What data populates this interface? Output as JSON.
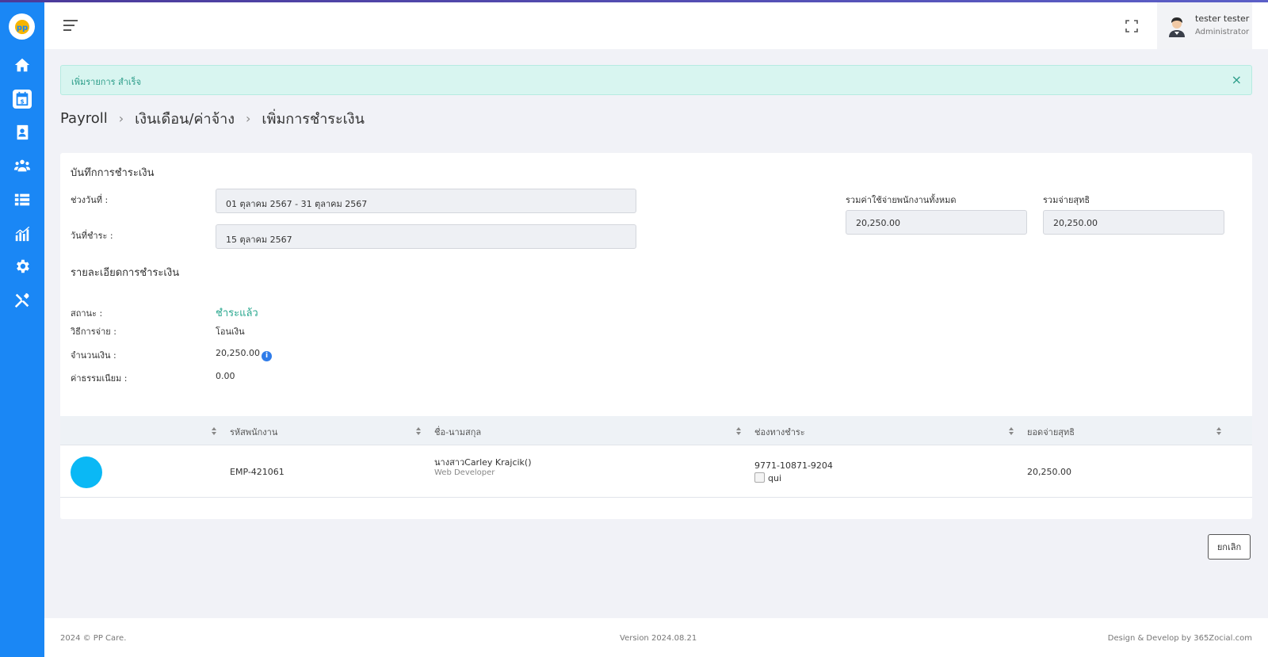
{
  "header": {
    "user_name": "tester tester",
    "user_role": "Administrator"
  },
  "sidebar": {
    "items": [
      {
        "icon": "home-icon"
      },
      {
        "icon": "payroll-calendar-icon",
        "active": true
      },
      {
        "icon": "contact-book-icon"
      },
      {
        "icon": "team-icon"
      },
      {
        "icon": "list-icon"
      },
      {
        "icon": "chart-icon"
      },
      {
        "icon": "settings-gear-icon"
      },
      {
        "icon": "tools-icon"
      }
    ]
  },
  "alert": {
    "message": "เพิ่มรายการ สำเร็จ",
    "close": "×"
  },
  "breadcrumb": {
    "items": [
      "Payroll",
      "เงินเดือน/ค่าจ้าง",
      "เพิ่มการชำระเงิน"
    ],
    "separator": "›"
  },
  "payment_record": {
    "title": "บันทึกการชำระเงิน",
    "period_label": "ช่วงวันที่ :",
    "period_value": "01 ตุลาคม 2567 - 31 ตุลาคม 2567",
    "pay_date_label": "วันที่ชำระ :",
    "pay_date_value": "15 ตุลาคม 2567",
    "total_expense_label": "รวมค่าใช้จ่ายพนักงานทั้งหมด",
    "total_expense_value": "20,250.00",
    "net_total_label": "รวมจ่ายสุทธิ",
    "net_total_value": "20,250.00"
  },
  "payment_details": {
    "title": "รายละเอียดการชำระเงิน",
    "status_label": "สถานะ :",
    "status_value": "ชำระแล้ว",
    "method_label": "วิธีการจ่าย :",
    "method_value": "โอนเงิน",
    "amount_label": "จำนวนเงิน :",
    "amount_value": "20,250.00",
    "amount_info": "i",
    "fee_label": "ค่าธรรมเนียม :",
    "fee_value": "0.00"
  },
  "table": {
    "headers": [
      "",
      "รหัสพนักงาน",
      "ชื่อ-นามสกุล",
      "ช่องทางชำระ",
      "ยอดจ่ายสุทธิ"
    ],
    "rows": [
      {
        "employee_id": "EMP-421061",
        "name": "นางสาวCarley Krajcik()",
        "position": "Web Developer",
        "account": "9771-10871-9204",
        "bank": "qui",
        "net": "20,250.00"
      }
    ]
  },
  "actions": {
    "cancel": "ยกเลิก"
  },
  "footer": {
    "copyright": "2024 © PP Care.",
    "version": "Version 2024.08.21",
    "credit": "Design & Develop by 365Zocial.com"
  },
  "colors": {
    "sidebar": "#1a87f5",
    "success": "#2aa88f",
    "avatar_circle": "#0ab8f5"
  }
}
